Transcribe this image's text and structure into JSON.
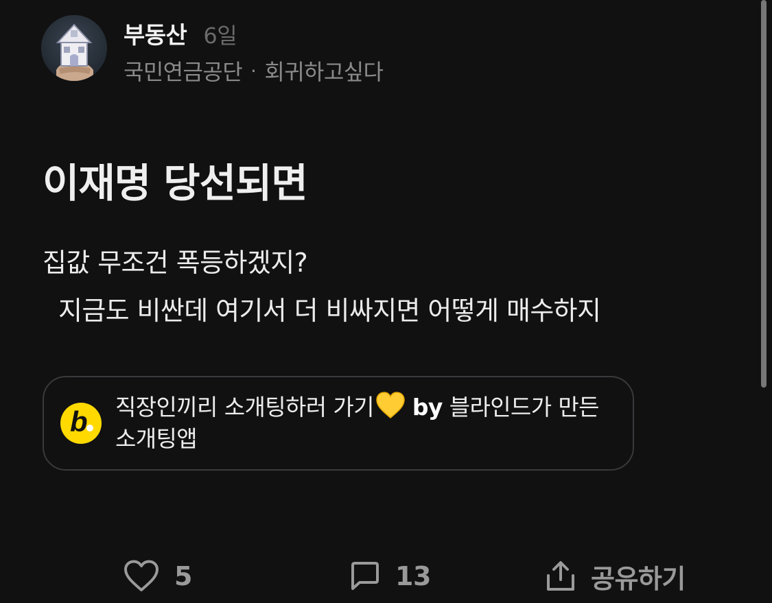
{
  "post": {
    "board": "부동산",
    "age": "6일",
    "company": "국민연금공단",
    "separator": "·",
    "nickname": "회귀하고싶다",
    "title": "이재명 당선되면",
    "body_line1": "집값 무조건 폭등하겠지?",
    "body_line2": "  지금도 비싼데 여기서 더 비싸지면 어떻게 매수하지"
  },
  "ad": {
    "logo_letter": "b",
    "text_part1": "직장인끼리 소개팅하러 가기",
    "emoji": "yellow-heart",
    "text_by": "by",
    "text_part2": " 블라인드가 만든 소개팅앱"
  },
  "actions": {
    "like_count": "5",
    "comment_count": "13",
    "share_label": "공유하기"
  },
  "icons": {
    "like": "heart-outline-icon",
    "comment": "comment-bubble-icon",
    "share": "share-upload-icon",
    "avatar": "house-in-hand-image"
  },
  "colors": {
    "background": "#111112",
    "logo_yellow": "#ffd900",
    "muted_text": "#8a8a8a",
    "action_gray": "#9a9a9a"
  }
}
